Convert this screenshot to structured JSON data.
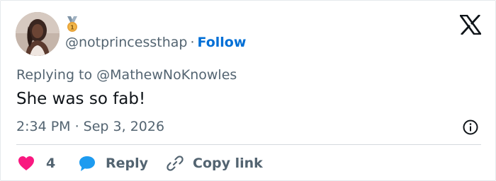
{
  "tweet": {
    "handle": "@notprincessthap",
    "separator": "·",
    "follow_label": "Follow",
    "replying_to": "Replying to @MathewNoKnowles",
    "text": "She was so fab!",
    "timestamp": "2:34 PM · Sep 3, 2026"
  },
  "actions": {
    "like_count": "4",
    "reply_label": "Reply",
    "copy_label": "Copy link"
  },
  "icons": {
    "badge": "medal-badge-icon",
    "logo": "x-logo-icon",
    "info": "info-icon",
    "like": "heart-icon",
    "reply": "chat-bubble-icon",
    "copy": "link-icon"
  },
  "colors": {
    "follow": "#006fd6",
    "muted": "#536471",
    "text": "#0f1419",
    "heart": "#f91880",
    "reply_bubble": "#1d9bf0",
    "badge_gold": "#e8a43b",
    "badge_ribbon": "#7f94a6"
  }
}
